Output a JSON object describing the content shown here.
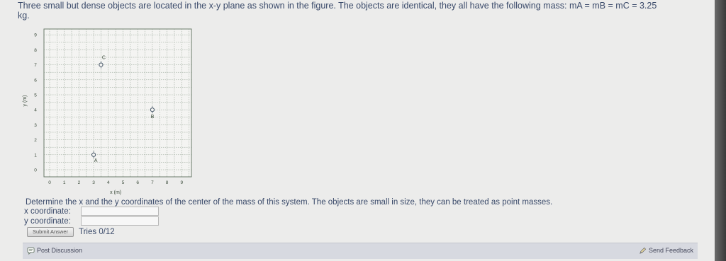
{
  "problem": {
    "intro_line1": "Three small but dense objects are located in the x-y plane as shown in the figure. The objects are identical, they all have the following mass: mA = mB = mC = 3.25",
    "intro_line2": "kg.",
    "question": "Determine the x and the y coordinates of the center of the mass of this system. The objects are small in size, they can be treated as point masses."
  },
  "figure": {
    "ylabel": "y (m)",
    "xlabel": "x (m)",
    "x_ticks": [
      "0",
      "1",
      "2",
      "3",
      "4",
      "5",
      "6",
      "7",
      "8",
      "9"
    ],
    "y_ticks": [
      "0",
      "1",
      "2",
      "3",
      "4",
      "5",
      "6",
      "7",
      "8",
      "9"
    ],
    "points": [
      {
        "label": "A",
        "x": 3,
        "y": 1
      },
      {
        "label": "B",
        "x": 7,
        "y": 4
      },
      {
        "label": "C",
        "x": 3.5,
        "y": 7
      }
    ]
  },
  "form": {
    "x_label": "x coordinate:",
    "y_label": "y coordinate:",
    "x_value": "",
    "y_value": "",
    "submit_label": "Submit Answer",
    "tries": "Tries 0/12"
  },
  "footer": {
    "post_discussion": "Post Discussion",
    "send_feedback": "Send Feedback"
  },
  "colors": {
    "text": "#3a4a6a",
    "grid": "#5a6a5a",
    "page_bg": "#ececeb"
  }
}
